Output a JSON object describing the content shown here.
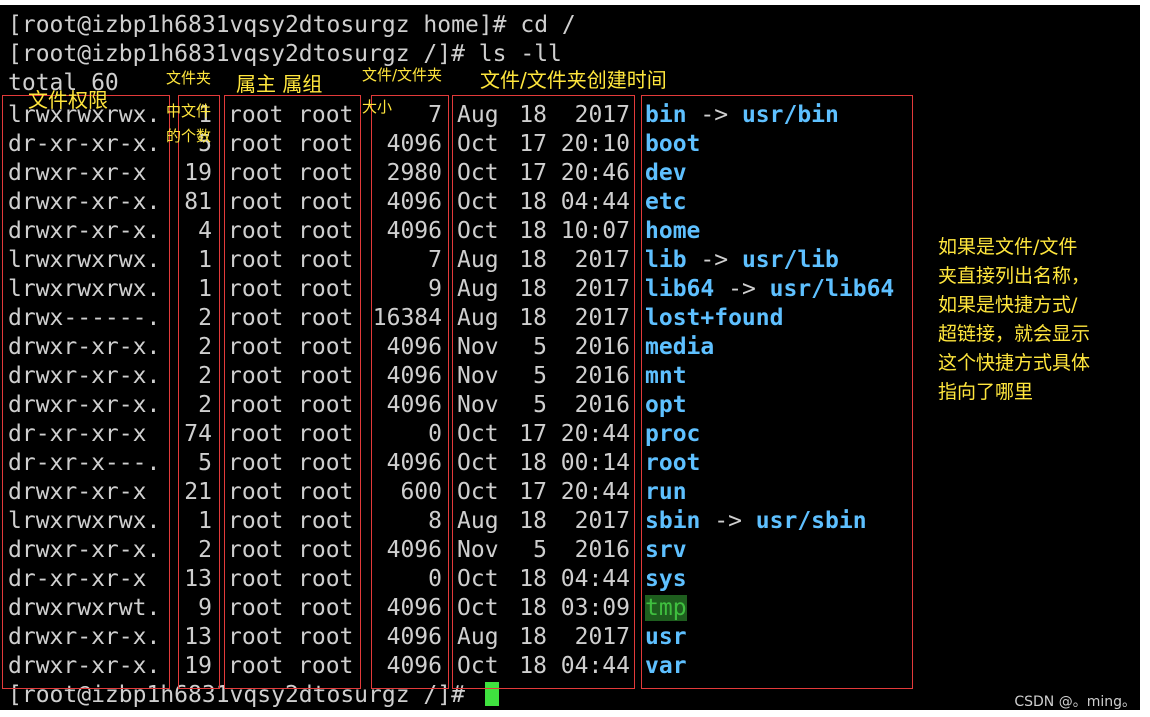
{
  "terminal": {
    "prompt_lines": [
      "[root@izbp1h6831vqsy2dtosurgz home]# cd /",
      "[root@izbp1h6831vqsy2dtosurgz /]# ls -ll",
      "total 60"
    ],
    "final_prompt": "[root@izbp1h6831vqsy2dtosurgz /]# ",
    "rows": [
      {
        "perm": "lrwxrwxrwx.",
        "links": "1",
        "owner": "root",
        "group": "root",
        "size": "7",
        "month": "Aug",
        "day": "18",
        "time": "2017",
        "name": "bin",
        "arrow": " -> ",
        "target": "usr/bin"
      },
      {
        "perm": "dr-xr-xr-x.",
        "links": "5",
        "owner": "root",
        "group": "root",
        "size": "4096",
        "month": "Oct",
        "day": "17",
        "time": "20:10",
        "name": "boot"
      },
      {
        "perm": "drwxr-xr-x",
        "links": "19",
        "owner": "root",
        "group": "root",
        "size": "2980",
        "month": "Oct",
        "day": "17",
        "time": "20:46",
        "name": "dev"
      },
      {
        "perm": "drwxr-xr-x.",
        "links": "81",
        "owner": "root",
        "group": "root",
        "size": "4096",
        "month": "Oct",
        "day": "18",
        "time": "04:44",
        "name": "etc"
      },
      {
        "perm": "drwxr-xr-x.",
        "links": "4",
        "owner": "root",
        "group": "root",
        "size": "4096",
        "month": "Oct",
        "day": "18",
        "time": "10:07",
        "name": "home"
      },
      {
        "perm": "lrwxrwxrwx.",
        "links": "1",
        "owner": "root",
        "group": "root",
        "size": "7",
        "month": "Aug",
        "day": "18",
        "time": "2017",
        "name": "lib",
        "arrow": " -> ",
        "target": "usr/lib"
      },
      {
        "perm": "lrwxrwxrwx.",
        "links": "1",
        "owner": "root",
        "group": "root",
        "size": "9",
        "month": "Aug",
        "day": "18",
        "time": "2017",
        "name": "lib64",
        "arrow": " -> ",
        "target": "usr/lib64"
      },
      {
        "perm": "drwx------.",
        "links": "2",
        "owner": "root",
        "group": "root",
        "size": "16384",
        "month": "Aug",
        "day": "18",
        "time": "2017",
        "name": "lost+found"
      },
      {
        "perm": "drwxr-xr-x.",
        "links": "2",
        "owner": "root",
        "group": "root",
        "size": "4096",
        "month": "Nov",
        "day": "5",
        "time": "2016",
        "name": "media"
      },
      {
        "perm": "drwxr-xr-x.",
        "links": "2",
        "owner": "root",
        "group": "root",
        "size": "4096",
        "month": "Nov",
        "day": "5",
        "time": "2016",
        "name": "mnt"
      },
      {
        "perm": "drwxr-xr-x.",
        "links": "2",
        "owner": "root",
        "group": "root",
        "size": "4096",
        "month": "Nov",
        "day": "5",
        "time": "2016",
        "name": "opt"
      },
      {
        "perm": "dr-xr-xr-x",
        "links": "74",
        "owner": "root",
        "group": "root",
        "size": "0",
        "month": "Oct",
        "day": "17",
        "time": "20:44",
        "name": "proc"
      },
      {
        "perm": "dr-xr-x---.",
        "links": "5",
        "owner": "root",
        "group": "root",
        "size": "4096",
        "month": "Oct",
        "day": "18",
        "time": "00:14",
        "name": "root"
      },
      {
        "perm": "drwxr-xr-x",
        "links": "21",
        "owner": "root",
        "group": "root",
        "size": "600",
        "month": "Oct",
        "day": "17",
        "time": "20:44",
        "name": "run"
      },
      {
        "perm": "lrwxrwxrwx.",
        "links": "1",
        "owner": "root",
        "group": "root",
        "size": "8",
        "month": "Aug",
        "day": "18",
        "time": "2017",
        "name": "sbin",
        "arrow": " -> ",
        "target": "usr/sbin"
      },
      {
        "perm": "drwxr-xr-x.",
        "links": "2",
        "owner": "root",
        "group": "root",
        "size": "4096",
        "month": "Nov",
        "day": "5",
        "time": "2016",
        "name": "srv"
      },
      {
        "perm": "dr-xr-xr-x",
        "links": "13",
        "owner": "root",
        "group": "root",
        "size": "0",
        "month": "Oct",
        "day": "18",
        "time": "04:44",
        "name": "sys"
      },
      {
        "perm": "drwxrwxrwt.",
        "links": "9",
        "owner": "root",
        "group": "root",
        "size": "4096",
        "month": "Oct",
        "day": "18",
        "time": "03:09",
        "name": "tmp",
        "highlight": true
      },
      {
        "perm": "drwxr-xr-x.",
        "links": "13",
        "owner": "root",
        "group": "root",
        "size": "4096",
        "month": "Aug",
        "day": "18",
        "time": "2017",
        "name": "usr"
      },
      {
        "perm": "drwxr-xr-x.",
        "links": "19",
        "owner": "root",
        "group": "root",
        "size": "4096",
        "month": "Oct",
        "day": "18",
        "time": "04:44",
        "name": "var"
      }
    ]
  },
  "annotations": {
    "permissions": "文件权限",
    "link_count_1": "文件夹",
    "link_count_2": "中文件",
    "link_count_3": "的个数",
    "owner_group": "属主 属组",
    "size_1": "文件/文件夹",
    "size_2": "大小",
    "created_time": "文件/文件夹创建时间",
    "side_note": [
      "如果是文件/文件",
      "夹直接列出名称，",
      "如果是快捷方式/",
      "超链接，就会显示",
      "这个快捷方式具体",
      "指向了哪里"
    ]
  },
  "watermark": "CSDN @。ming。",
  "colors": {
    "terminal_bg": "#000000",
    "text": "#cfcfcf",
    "directory": "#5ec0ff",
    "annotation": "#ffe63d",
    "box": "#e23a3a",
    "cursor": "#3fe23f",
    "tmp_highlight_bg": "#1e5e1e"
  }
}
